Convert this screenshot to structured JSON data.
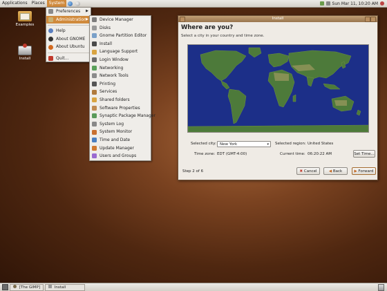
{
  "top_panel": {
    "menus": [
      "Applications",
      "Places",
      "System"
    ],
    "datetime": "Sun Mar 11, 10:20 AM"
  },
  "desktop": {
    "icons": [
      {
        "label": "Examples",
        "icon": "folder-icon"
      },
      {
        "label": "Install",
        "icon": "drive-icon"
      }
    ]
  },
  "system_menu": {
    "items": [
      {
        "label": "Preferences",
        "icon": "preferences-icon",
        "submenu": true
      },
      {
        "label": "Administration",
        "icon": "administration-icon",
        "submenu": true,
        "highlighted": true
      },
      {
        "label": "Help",
        "icon": "help-icon"
      },
      {
        "label": "About GNOME",
        "icon": "gnome-icon"
      },
      {
        "label": "About Ubuntu",
        "icon": "ubuntu-icon"
      },
      {
        "label": "Quit...",
        "icon": "quit-icon"
      }
    ]
  },
  "admin_menu": {
    "items": [
      "Device Manager",
      "Disks",
      "Gnome Partition Editor",
      "Install",
      "Language Support",
      "Login Window",
      "Networking",
      "Network Tools",
      "Printing",
      "Services",
      "Shared folders",
      "Software Properties",
      "Synaptic Package Manager",
      "System Log",
      "System Monitor",
      "Time and Date",
      "Update Manager",
      "Users and Groups"
    ]
  },
  "install_window": {
    "title": "Install",
    "heading": "Where are you?",
    "subheading": "Select a city in your country and time zone.",
    "selected_city_label": "Selected city:",
    "selected_city": "New York",
    "selected_region_label": "Selected region:",
    "selected_region": "United States",
    "time_zone_label": "Time zone:",
    "time_zone": "EDT (GMT-4:00)",
    "current_time_label": "Current time:",
    "current_time": "06:20:22 AM",
    "set_time_button": "Set Time...",
    "step": "Step 2 of 6",
    "cancel_button": "Cancel",
    "back_button": "Back",
    "forward_button": "Forward"
  },
  "bottom_panel": {
    "tasks": [
      "[The GIMP]",
      "Install"
    ]
  },
  "colors": {
    "highlight": "#d08a3c",
    "ocean": "#1c2f88",
    "land": "#4d7a3a"
  }
}
